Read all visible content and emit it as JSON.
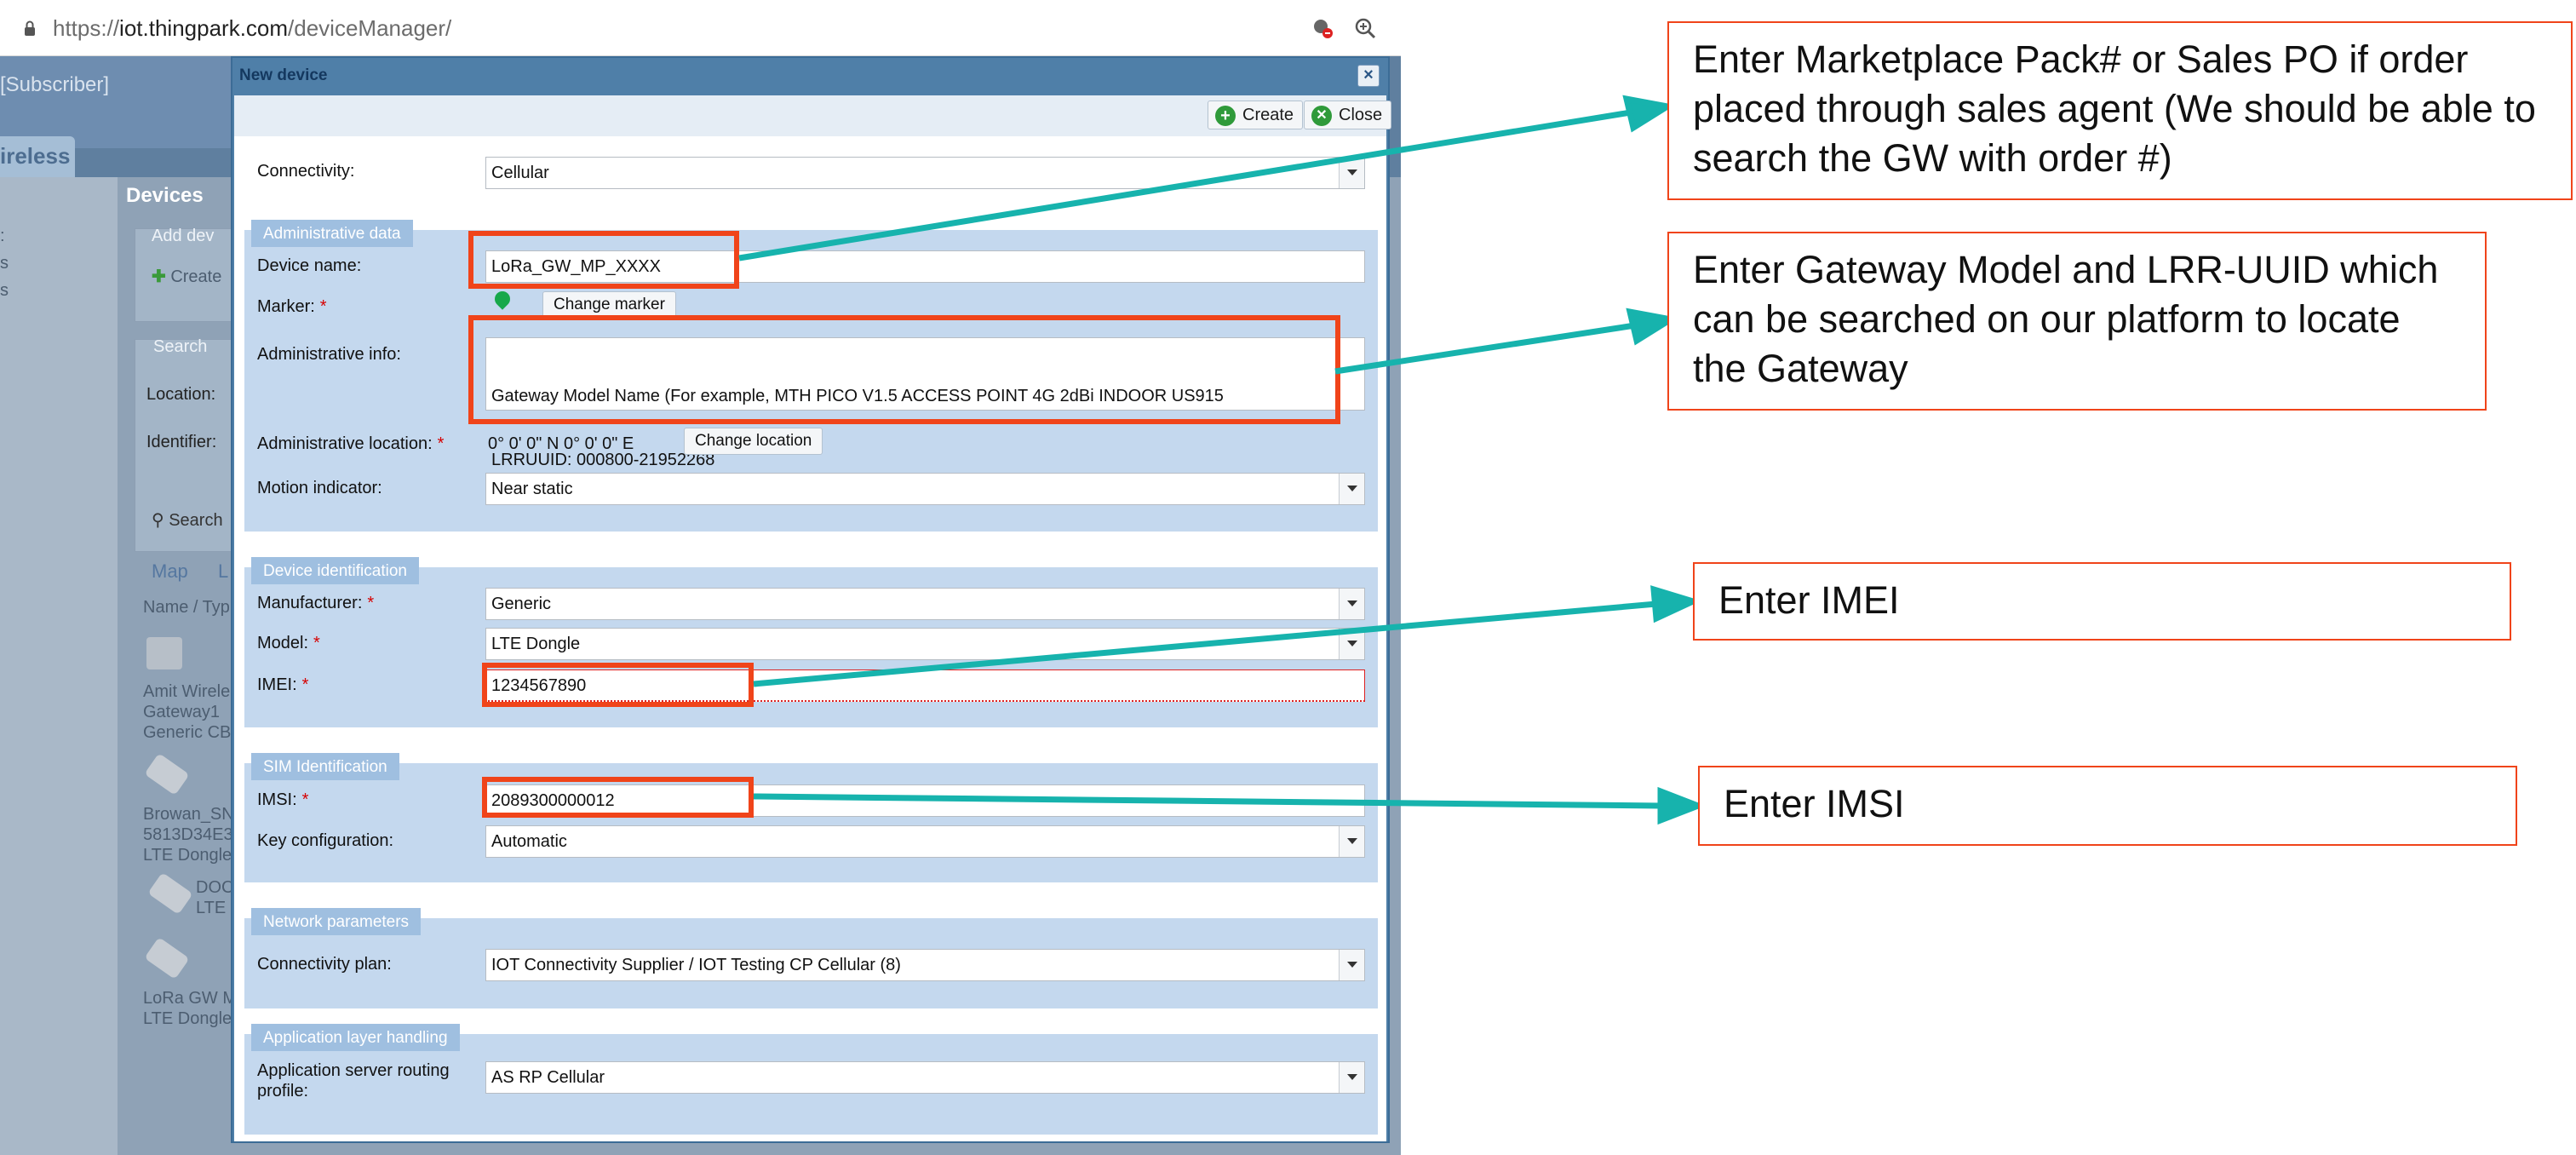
{
  "browser": {
    "url_prefix": "https://",
    "url_host": "iot.thingpark.com",
    "url_path": "/deviceManager/"
  },
  "background_app": {
    "subscriber_label": "[Subscriber]",
    "wireless_tab": "ireless",
    "devices_title": "Devices",
    "add_device_label": "Add dev",
    "create_label": "Create",
    "search_label": "Search",
    "location_label": "Location:",
    "identifier_label": "Identifier:",
    "search_button": "Search",
    "tabs": [
      "Map",
      "L"
    ],
    "list_header": "Name / Typ",
    "list_items": [
      {
        "line1": "Amit Wirele",
        "line2": "Gateway1",
        "line3": "Generic CBI"
      },
      {
        "line1": "Browan_SN",
        "line2": "5813D34E3",
        "line3": "LTE Dongle"
      },
      {
        "line1": "DOC",
        "line2": "LTE",
        "line3": ""
      },
      {
        "line1": "LoRa GW M",
        "line2": "LTE Dongle",
        "line3": ""
      }
    ]
  },
  "dialog": {
    "title": "New device",
    "close_x": "×",
    "create_button": "Create",
    "close_button": "Close",
    "connectivity_label": "Connectivity:",
    "connectivity_value": "Cellular",
    "sections": {
      "admin": "Administrative data",
      "device_id": "Device identification",
      "sim": "SIM Identification",
      "network": "Network parameters",
      "app_layer": "Application layer handling"
    },
    "device_name_label": "Device name:",
    "device_name_value": "LoRa_GW_MP_XXXX",
    "marker_label": "Marker:",
    "change_marker_button": "Change marker",
    "admin_info_label": "Administrative info:",
    "admin_info_line1": "Gateway Model Name (For example, MTH PICO V1.5 ACCESS POINT 4G 2dBi INDOOR US915",
    "admin_info_line2": "LRRUUID: 000800-21952268",
    "admin_location_label": "Administrative location:",
    "admin_location_value": "0° 0' 0\" N  0° 0' 0\" E",
    "change_location_button": "Change location",
    "motion_label": "Motion indicator:",
    "motion_value": "Near static",
    "manufacturer_label": "Manufacturer:",
    "manufacturer_value": "Generic",
    "model_label": "Model:",
    "model_value": "LTE Dongle",
    "imei_label": "IMEI:",
    "imei_value": "1234567890",
    "imsi_label": "IMSI:",
    "imsi_value": "2089300000012",
    "key_config_label": "Key configuration:",
    "key_config_value": "Automatic",
    "connectivity_plan_label": "Connectivity plan:",
    "connectivity_plan_value": "IOT Connectivity Supplier / IOT Testing CP Cellular (8)",
    "as_routing_label_line1": "Application server routing",
    "as_routing_label_line2": "profile:",
    "as_routing_value": "AS RP Cellular",
    "required_marker": "*"
  },
  "callouts": {
    "marketplace": "Enter Marketplace Pack# or Sales PO if order placed through sales agent (We should be able to search the GW with order #)",
    "gateway_model": "Enter Gateway Model and LRR-UUID which can be searched on our platform to locate the Gateway",
    "imei": "Enter IMEI",
    "imsi": "Enter IMSI"
  },
  "colors": {
    "highlight": "#f0441a",
    "arrow": "#17b3ad",
    "section_bg": "#c4d8ee",
    "section_title_bg": "#9fbfe0",
    "dialog_frame": "#4f7fa8"
  }
}
